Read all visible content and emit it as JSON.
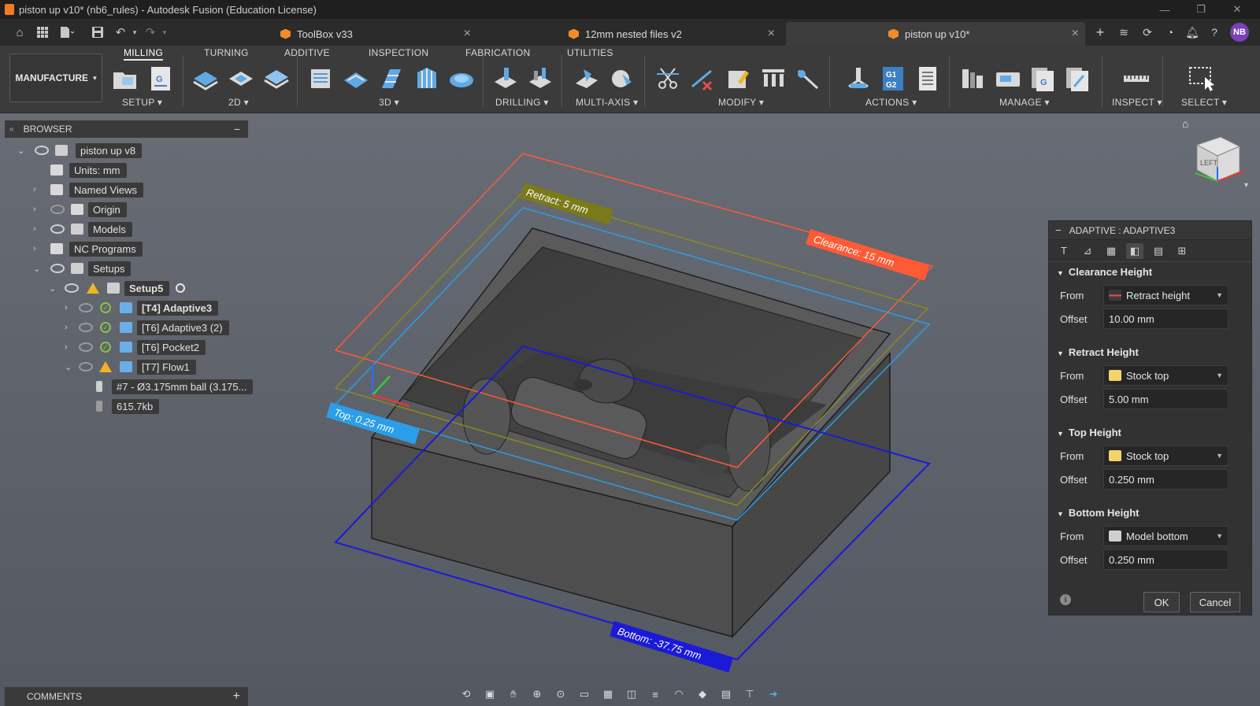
{
  "window": {
    "title": "piston up v10* (nb6_rules) - Autodesk Fusion (Education License)",
    "controls": [
      "—",
      "❐",
      "✕"
    ]
  },
  "tabs": [
    {
      "label": "ToolBox v33",
      "active": false
    },
    {
      "label": "12mm nested files v2",
      "active": false
    },
    {
      "label": "piston up v10*",
      "active": true
    }
  ],
  "user": {
    "initials": "NB"
  },
  "ribbon": {
    "workspace": "MANUFACTURE",
    "tabs": [
      "MILLING",
      "TURNING",
      "ADDITIVE",
      "INSPECTION",
      "FABRICATION",
      "UTILITIES"
    ],
    "groups": [
      "SETUP ▾",
      "2D ▾",
      "3D ▾",
      "DRILLING ▾",
      "MULTI-AXIS ▾",
      "MODIFY ▾",
      "ACTIONS ▾",
      "MANAGE ▾",
      "INSPECT ▾",
      "SELECT ▾"
    ]
  },
  "browser": {
    "title": "BROWSER",
    "items": [
      {
        "label": "piston up v8"
      },
      {
        "label": "Units: mm"
      },
      {
        "label": "Named Views"
      },
      {
        "label": "Origin"
      },
      {
        "label": "Models"
      },
      {
        "label": "NC Programs"
      },
      {
        "label": "Setups"
      },
      {
        "label": "Setup5"
      },
      {
        "label": "[T4] Adaptive3"
      },
      {
        "label": "[T6] Adaptive3 (2)"
      },
      {
        "label": "[T6] Pocket2"
      },
      {
        "label": "[T7] Flow1"
      },
      {
        "label": "#7 - Ø3.175mm ball (3.175..."
      },
      {
        "label": "615.7kb"
      }
    ]
  },
  "comments": {
    "title": "COMMENTS"
  },
  "viewport": {
    "labels": {
      "retract": "Retract: 5 mm",
      "clearance": "Clearance: 15 mm",
      "top": "Top: 0.25 mm",
      "bottom": "Bottom: -37.75 mm"
    },
    "viewcube": {
      "face": "LEFT"
    },
    "colors": {
      "clearance": "#ff5a36",
      "retract": "#8a8a1a",
      "top": "#2a9ee8",
      "bottom": "#1a1ad8"
    }
  },
  "panel": {
    "title": "ADAPTIVE : ADAPTIVE3",
    "sections": [
      {
        "title": "Clearance Height",
        "from_label": "From",
        "from": "Retract height",
        "offset_label": "Offset",
        "offset": "10.00 mm"
      },
      {
        "title": "Retract Height",
        "from_label": "From",
        "from": "Stock top",
        "offset_label": "Offset",
        "offset": "5.00 mm"
      },
      {
        "title": "Top Height",
        "from_label": "From",
        "from": "Stock top",
        "offset_label": "Offset",
        "offset": "0.250 mm"
      },
      {
        "title": "Bottom Height",
        "from_label": "From",
        "from": "Model bottom",
        "offset_label": "Offset",
        "offset": "0.250 mm"
      }
    ],
    "ok": "OK",
    "cancel": "Cancel"
  }
}
